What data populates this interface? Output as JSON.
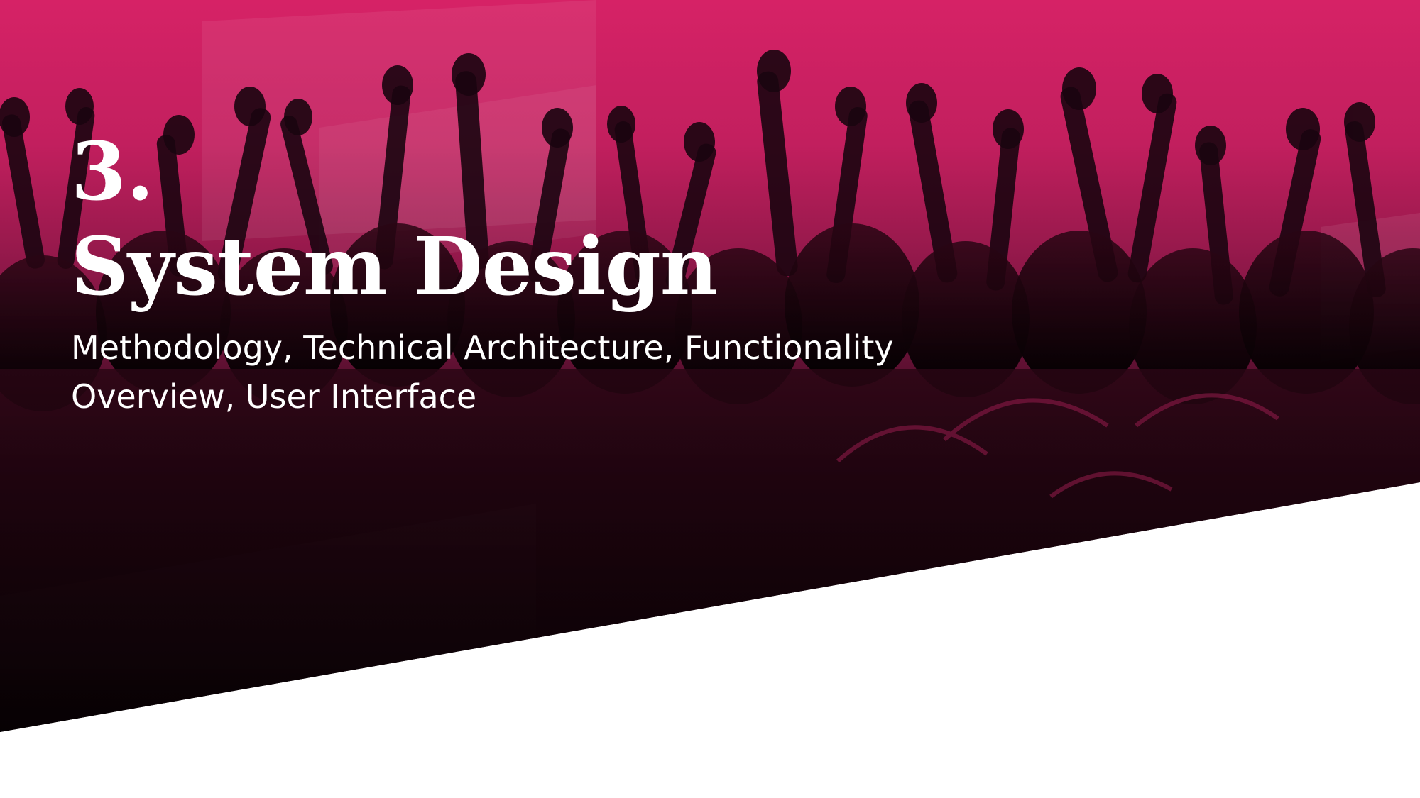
{
  "slide": {
    "number": "3.",
    "title": "System Design",
    "subtitle": "Methodology, Technical Architecture, Functionality Overview, User Interface"
  },
  "colors": {
    "accent": "#d62266",
    "background": "#ffffff",
    "text": "#ffffff"
  }
}
